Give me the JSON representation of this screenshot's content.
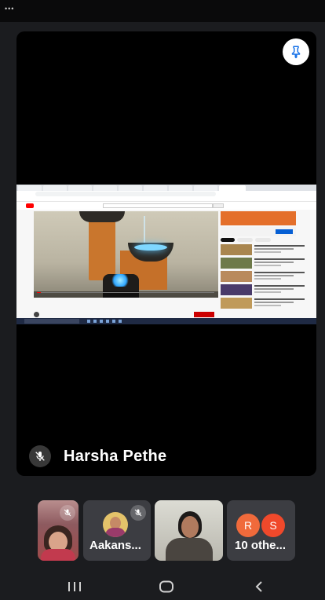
{
  "status_bar": {
    "indicator": "•••"
  },
  "main_tile": {
    "speaker_name": "Harsha Pethe",
    "shared_screen": {
      "video_progress": 0.02
    }
  },
  "participants": [
    {
      "id": "p1",
      "type": "video",
      "muted": true
    },
    {
      "id": "p2",
      "type": "avatar",
      "name": "Aakans...",
      "muted": true
    },
    {
      "id": "p3",
      "type": "video",
      "muted": false
    },
    {
      "id": "others",
      "type": "group",
      "label": "10 othe...",
      "avatar_letters": [
        "R",
        "S"
      ]
    }
  ],
  "colors": {
    "background": "#1b1c1f",
    "tile_background": "#3c3d42",
    "avatar_r": "#f06a3b",
    "avatar_s": "#f0492b",
    "pin_icon": "#1a73e8"
  },
  "icons": {
    "pin": "push-pin-icon",
    "mic_off": "mic-off-icon",
    "recent_apps": "recent-apps-icon",
    "home": "home-icon",
    "back": "back-icon"
  }
}
